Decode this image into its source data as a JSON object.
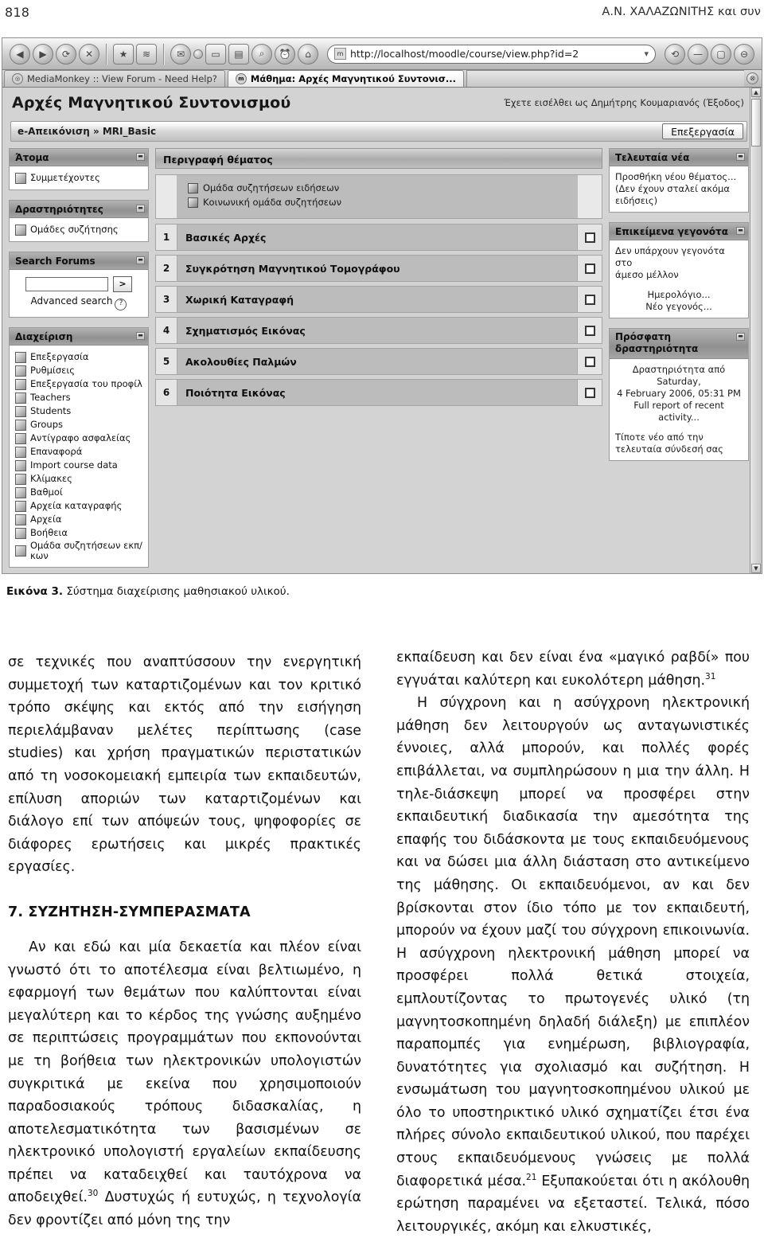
{
  "running_head": {
    "folio": "818",
    "authors": "Α.Ν. ΧΑΛΑΖΩΝΙΤΗΣ και συν"
  },
  "browser": {
    "url": "http://localhost/moodle/course/view.php?id=2",
    "url_favicon_glyph": "m",
    "dropdown_glyph": "▾",
    "toolbar_icons": [
      {
        "name": "back-icon",
        "glyph": "◀"
      },
      {
        "name": "forward-icon",
        "glyph": "▶"
      },
      {
        "name": "reload-icon",
        "glyph": "⟳"
      },
      {
        "name": "stop-icon",
        "glyph": "✕"
      },
      {
        "name": "add-bookmark-icon",
        "glyph": "★"
      },
      {
        "name": "add-feed-icon",
        "glyph": "≋"
      },
      {
        "name": "mail-icon",
        "glyph": "✉"
      },
      {
        "name": "dot-icon",
        "glyph": "•"
      },
      {
        "name": "page-icon",
        "glyph": "▭"
      },
      {
        "name": "notes-icon",
        "glyph": "▤"
      },
      {
        "name": "search-web-icon",
        "glyph": "⌕"
      },
      {
        "name": "alarm-icon",
        "glyph": "⏰"
      },
      {
        "name": "home-icon",
        "glyph": "⌂"
      }
    ],
    "right_icons": [
      {
        "name": "history-icon",
        "glyph": "⟲"
      },
      {
        "name": "minimize-window-icon",
        "glyph": "—"
      },
      {
        "name": "restore-window-icon",
        "glyph": "▢"
      },
      {
        "name": "close-window-icon",
        "glyph": "⊖"
      }
    ],
    "tabs": [
      {
        "label": "MediaMonkey :: View Forum - Need Help?",
        "active": false
      },
      {
        "label": "Μάθημα: Αρχές Μαγνητικού Συντονισ...",
        "active": true
      }
    ],
    "close_tab_glyph": "⊗"
  },
  "moodle": {
    "course_title": "Αρχές Μαγνητικού Συντονισμού",
    "login_info": "Έχετε εισέλθει ως Δημήτρης Κουμαριανός (Έξοδος)",
    "breadcrumb": "e-Απεικόνιση » MRI_Basic",
    "edit_button": "Επεξεργασία",
    "left_blocks": [
      {
        "title": "Άτομα",
        "minimize_glyph": "▬",
        "items": [
          {
            "label": "Συμμετέχοντες",
            "icon": "users-icon"
          }
        ]
      },
      {
        "title": "Δραστηριότητες",
        "minimize_glyph": "▬",
        "items": [
          {
            "label": "Ομάδες συζήτησης",
            "icon": "forum-icon"
          }
        ]
      }
    ],
    "search_block": {
      "title": "Search Forums",
      "minimize_glyph": "▬",
      "input_value": "",
      "go_label": ">",
      "advanced_search_label": "Advanced search",
      "help_glyph": "?"
    },
    "admin_block": {
      "title": "Διαχείριση",
      "minimize_glyph": "▬",
      "items": [
        {
          "label": "Επεξεργασία",
          "icon": "edit-icon"
        },
        {
          "label": "Ρυθμίσεις",
          "icon": "settings-icon"
        },
        {
          "label": "Επεξεργασία του προφίλ",
          "icon": "profile-icon"
        },
        {
          "label": "Teachers",
          "icon": "teachers-icon"
        },
        {
          "label": "Students",
          "icon": "students-icon"
        },
        {
          "label": "Groups",
          "icon": "groups-icon"
        },
        {
          "label": "Αντίγραφο ασφαλείας",
          "icon": "backup-icon"
        },
        {
          "label": "Επαναφορά",
          "icon": "restore-icon"
        },
        {
          "label": "Import course data",
          "icon": "import-icon"
        },
        {
          "label": "Κλίμακες",
          "icon": "scales-icon"
        },
        {
          "label": "Βαθμοί",
          "icon": "grades-icon"
        },
        {
          "label": "Αρχεία καταγραφής",
          "icon": "logs-icon"
        },
        {
          "label": "Αρχεία",
          "icon": "files-icon"
        },
        {
          "label": "Βοήθεια",
          "icon": "help-icon"
        },
        {
          "label": "Ομάδα συζητήσεων εκπ/κων",
          "icon": "teacher-forum-icon"
        }
      ]
    },
    "center": {
      "topic_outline_title": "Περιγραφή θέματος",
      "intro_links": [
        {
          "label": "Ομάδα συζητήσεων ειδήσεων",
          "icon": "forum-icon"
        },
        {
          "label": "Κοινωνική ομάδα συζητήσεων",
          "icon": "forum-icon"
        }
      ],
      "topics": [
        {
          "number": "1",
          "label": "Βασικές Αρχές"
        },
        {
          "number": "2",
          "label": "Συγκρότηση Μαγνητικού Τομογράφου"
        },
        {
          "number": "3",
          "label": "Χωρική Καταγραφή"
        },
        {
          "number": "4",
          "label": "Σχηματισμός Εικόνας"
        },
        {
          "number": "5",
          "label": "Ακολουθίες Παλμών"
        },
        {
          "number": "6",
          "label": "Ποιότητα Εικόνας"
        }
      ]
    },
    "right_blocks": [
      {
        "title": "Τελευταία νέα",
        "minimize_glyph": "▬",
        "lines": [
          "Προσθήκη νέου θέματος...",
          "(Δεν έχουν σταλεί ακόμα",
          "ειδήσεις)"
        ]
      },
      {
        "title": "Επικείμενα γεγονότα",
        "minimize_glyph": "▬",
        "lines": [
          "Δεν υπάρχουν γεγονότα στο",
          "άμεσο μέλλον"
        ],
        "links": [
          "Ημερολόγιο...",
          "Νέο γεγονός..."
        ]
      },
      {
        "title": "Πρόσφατη δραστηριότητα",
        "minimize_glyph": "▬",
        "lines": [
          "Δραστηριότητα από Saturday,",
          "4 February 2006, 05:31 PM",
          "Full report of recent",
          "activity..."
        ],
        "footer_lines": [
          "Τίποτε νέο από την",
          "τελευταία σύνδεσή σας"
        ]
      }
    ]
  },
  "figure_caption": {
    "label": "Εικόνα 3.",
    "text": " Σύστημα διαχείρισης μαθησιακού υλικού."
  },
  "article": {
    "left_column": {
      "continued_paragraph": "σε τεχνικές που αναπτύσσουν την ενεργητική συμμετοχή των καταρτιζομένων και τον κριτικό τρόπο σκέψης και εκτός από την εισήγηση περιελάμβαναν μελέτες περίπτωσης (case studies) και χρήση πραγματικών περιστατικών από τη νοσοκομειακή εμπειρία των εκπαιδευτών, επίλυση αποριών των καταρτιζομένων και διάλογο επί των απόψεών τους, ψηφοφορίες σε διάφορες ερωτήσεις και μικρές πρακτικές εργασίες.",
      "section_heading": "7. ΣΥΖΗΤΗΣΗ-ΣΥΜΠΕΡΑΣΜΑΤΑ",
      "paragraph_1_part_a": "Αν και εδώ και μία δεκαετία και πλέον είναι γνωστό ότι το αποτέλεσμα είναι βελτιωμένο, η εφαρμογή των θεμάτων που καλύπτονται είναι μεγαλύτερη και το κέρδος της γνώσης αυξημένο σε περιπτώσεις προγραμμάτων που εκπονούνται με τη βοήθεια των ηλεκτρονικών υπολογιστών συγκριτικά με εκείνα που χρησιμοποιούν παραδοσιακούς τρόπους διδασκαλίας, η αποτελεσματικότητα των βασισμένων σε ηλεκτρονικό υπολογιστή εργαλείων εκπαίδευσης πρέπει να καταδειχθεί και ταυτόχρονα να αποδειχθεί.",
      "paragraph_1_ref": "30",
      "paragraph_1_part_b": " Δυστυχώς ή ευτυχώς, η τεχνολογία δεν φροντίζει από μόνη της την"
    },
    "right_column": {
      "paragraph_1_part_a": "εκπαίδευση και δεν είναι ένα «μαγικό ραβδί» που εγγυάται καλύτερη και ευκολότερη μάθηση.",
      "paragraph_1_ref": "31",
      "paragraph_2_part_a": "Η σύγχρονη και η ασύγχρονη ηλεκτρονική μάθηση δεν λειτουργούν ως ανταγωνιστικές έννοιες, αλλά μπορούν, και πολλές φορές επιβάλλεται, να συμπληρώσουν η μια την άλλη. Η τηλε-διάσκεψη μπορεί να προσφέρει στην εκπαιδευτική διαδικασία την αμεσότητα της επαφής του διδάσκοντα με τους εκπαιδευόμενους και να δώσει μια άλλη διάσταση στο αντικείμενο της μάθησης. Οι εκπαιδευόμενοι, αν και δεν βρίσκονται στον ίδιο τόπο με τον εκπαιδευτή, μπορούν να έχουν μαζί του σύγχρονη επικοινωνία. Η ασύγχρονη ηλεκτρονική μάθηση μπορεί να προσφέρει πολλά θετικά στοιχεία, εμπλουτίζοντας το πρωτογενές υλικό (τη μαγνητοσκοπημένη δηλαδή διάλεξη) με επιπλέον παραπομπές για ενημέρωση, βιβλιογραφία, δυνατότητες για σχολιασμό και συζήτηση. Η ενσωμάτωση του μαγνητοσκοπημένου υλικού με όλο το υποστηρικτικό υλικό σχηματίζει έτσι ένα πλήρες σύνολο εκπαιδευτικού υλικού, που παρέχει στους εκπαιδευόμενους γνώσεις με πολλά διαφορετικά μέσα.",
      "paragraph_2_ref": "21",
      "paragraph_2_part_b": " Εξυπακούεται ότι η ακόλουθη ερώτηση παραμένει να εξεταστεί. Τελικά, πόσο λειτουργικές, ακόμη και ελκυστικές,"
    }
  }
}
